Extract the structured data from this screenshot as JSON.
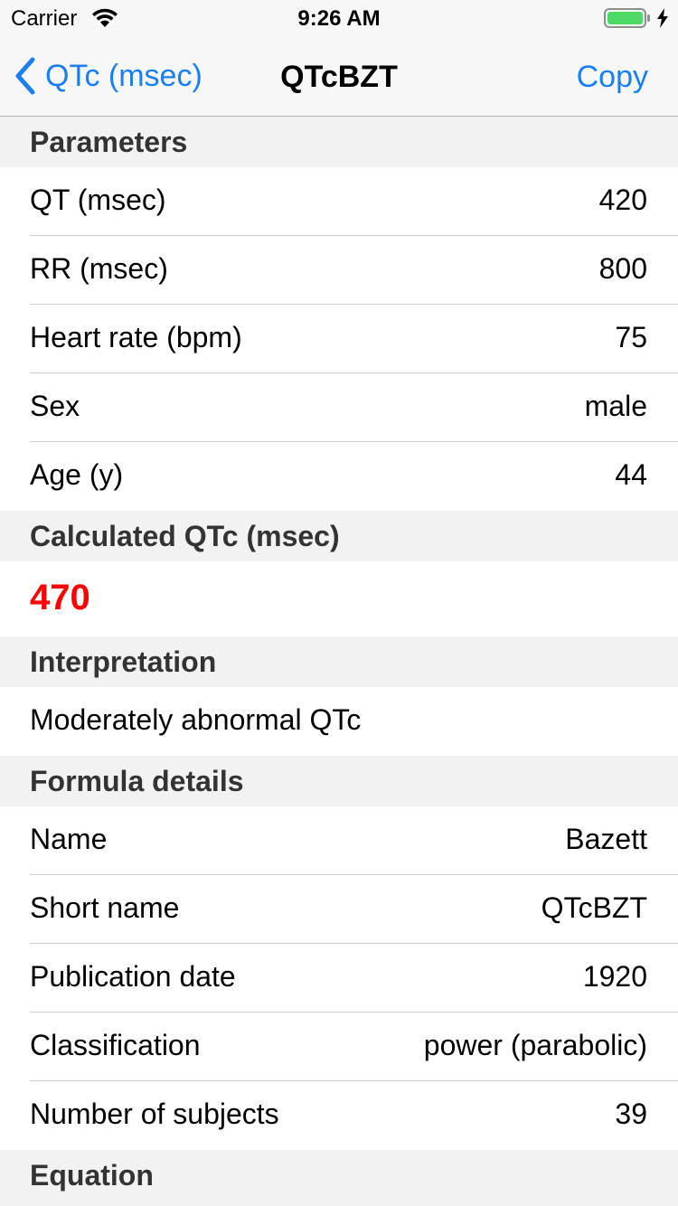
{
  "status": {
    "carrier": "Carrier",
    "time": "9:26 AM"
  },
  "nav": {
    "back_label": "QTc (msec)",
    "title": "QTcBZT",
    "copy_label": "Copy"
  },
  "accent_color": "#1a7ff2",
  "parameters": {
    "header": "Parameters",
    "rows": [
      {
        "label": "QT (msec)",
        "value": "420"
      },
      {
        "label": "RR (msec)",
        "value": "800"
      },
      {
        "label": "Heart rate (bpm)",
        "value": "75"
      },
      {
        "label": "Sex",
        "value": "male"
      },
      {
        "label": "Age (y)",
        "value": "44"
      }
    ]
  },
  "calculated": {
    "header": "Calculated QTc (msec)",
    "value": "470",
    "color": "#ff0000"
  },
  "interpretation": {
    "header": "Interpretation",
    "text": "Moderately abnormal QTc"
  },
  "formula": {
    "header": "Formula details",
    "rows": [
      {
        "label": "Name",
        "value": "Bazett"
      },
      {
        "label": "Short name",
        "value": "QTcBZT"
      },
      {
        "label": "Publication date",
        "value": "1920"
      },
      {
        "label": "Classification",
        "value": "power (parabolic)"
      },
      {
        "label": "Number of subjects",
        "value": "39"
      }
    ]
  },
  "equation": {
    "header": "Equation"
  }
}
